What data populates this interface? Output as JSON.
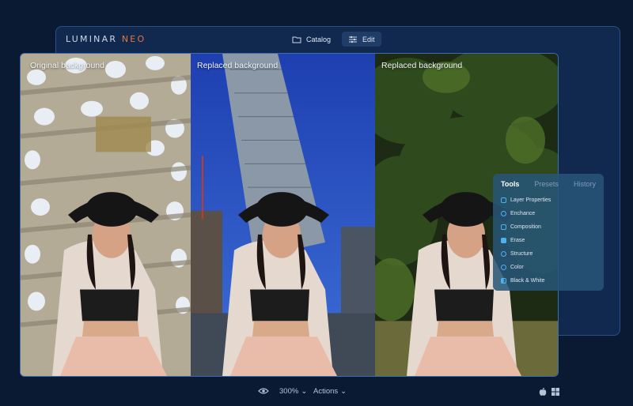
{
  "app": {
    "brand_main": "LUMINAR",
    "brand_accent": " NEO",
    "accent_color": "#e4763a"
  },
  "topnav": {
    "catalog_label": "Catalog",
    "edit_label": "Edit"
  },
  "panels": [
    {
      "label": "Original background"
    },
    {
      "label": "Replaced background"
    },
    {
      "label": "Replaced background"
    }
  ],
  "tools_panel": {
    "tabs": [
      "Tools",
      "Presets",
      "History"
    ],
    "active_tab": "Tools",
    "items": [
      {
        "label": "Layer Properties",
        "icon": "layer-properties-icon"
      },
      {
        "label": "Enchance",
        "icon": "enhance-icon"
      },
      {
        "label": "Composition",
        "icon": "composition-icon"
      },
      {
        "label": "Erase",
        "icon": "erase-icon"
      },
      {
        "label": "Structure",
        "icon": "structure-icon"
      },
      {
        "label": "Color",
        "icon": "color-icon"
      },
      {
        "label": "Black & White",
        "icon": "black-white-icon"
      }
    ]
  },
  "bottombar": {
    "zoom": "300%",
    "actions_label": "Actions"
  }
}
